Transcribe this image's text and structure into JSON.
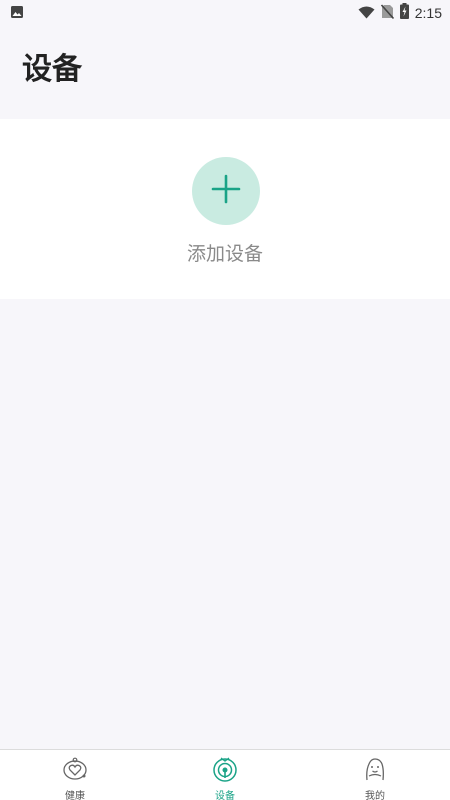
{
  "status_bar": {
    "time": "2:15",
    "icons": [
      "image-icon",
      "wifi-icon",
      "no-sim-icon",
      "battery-charging-icon"
    ]
  },
  "page": {
    "title": "设备"
  },
  "add_device": {
    "label": "添加设备",
    "icon": "plus-icon"
  },
  "bottom_nav": {
    "items": [
      {
        "label": "健康",
        "icon": "health-heart-icon",
        "active": false
      },
      {
        "label": "设备",
        "icon": "device-signal-icon",
        "active": true
      },
      {
        "label": "我的",
        "icon": "profile-person-icon",
        "active": false
      }
    ]
  },
  "colors": {
    "accent": "#1aa387",
    "add_circle": "#c9ebe1",
    "background": "#f7f6fa",
    "card": "#ffffff"
  }
}
